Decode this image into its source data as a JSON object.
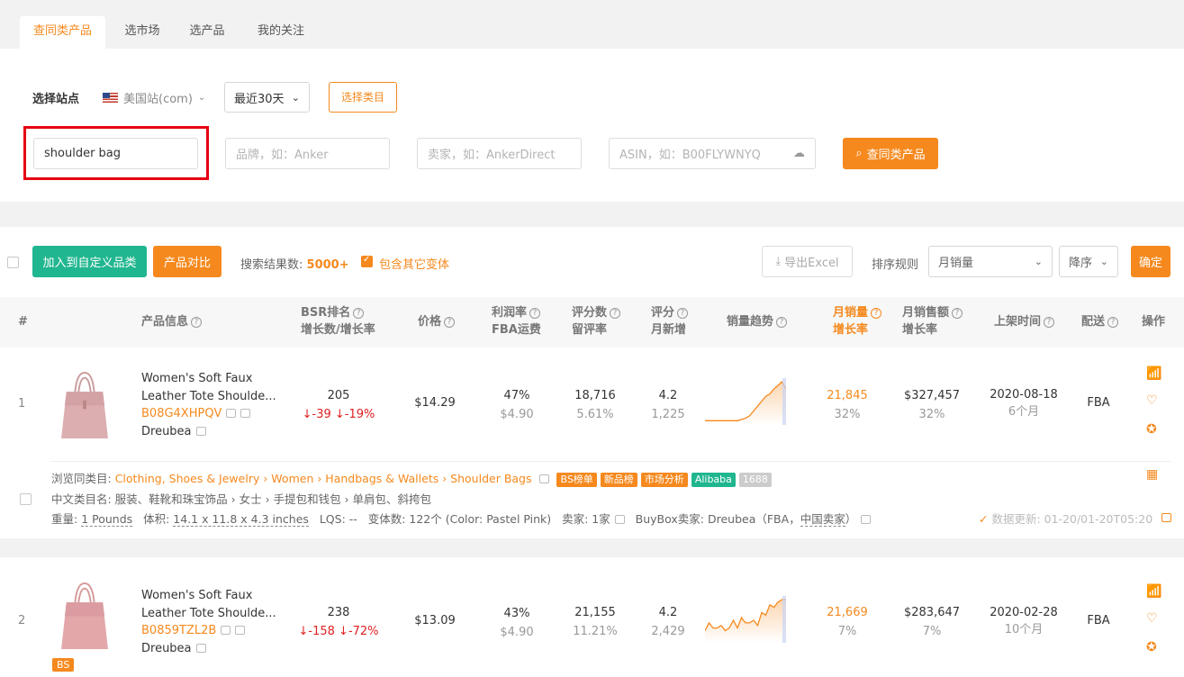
{
  "tabs": [
    {
      "label": "查同类产品",
      "active": true
    },
    {
      "label": "选市场"
    },
    {
      "label": "选产品"
    },
    {
      "label": "我的关注"
    }
  ],
  "filters": {
    "site_label": "选择站点",
    "site_value": "美国站(com)",
    "period_value": "最近30天",
    "category_button": "选择类目",
    "keyword_value": "shoulder bag",
    "brand_placeholder": "品牌，如：Anker",
    "seller_placeholder": "卖家，如：AnkerDirect",
    "asin_placeholder": "ASIN，如：B00FLYWNYQ",
    "search_button": "查同类产品"
  },
  "toolbar": {
    "add_category_button": "加入到自定义品类",
    "compare_button": "产品对比",
    "result_label": "搜索结果数:",
    "result_count": "5000+",
    "include_variants": "包含其它变体",
    "export_button": "导出Excel",
    "sort_label": "排序规则",
    "sort_field": "月销量",
    "sort_order": "降序",
    "confirm_button": "确定"
  },
  "columns": {
    "index": "#",
    "product": "产品信息",
    "bsr": "BSR排名",
    "bsr_sub": "增长数/增长率",
    "price": "价格",
    "profit": "利润率",
    "profit_sub": "FBA运费",
    "reviews": "评分数",
    "reviews_sub": "留评率",
    "rating": "评分",
    "rating_sub": "月新增",
    "trend": "销量趋势",
    "monthly_sales": "月销量",
    "monthly_sales_sub": "增长率",
    "monthly_revenue": "月销售额",
    "monthly_revenue_sub": "增长率",
    "listed": "上架时间",
    "delivery": "配送",
    "action": "操作"
  },
  "products": [
    {
      "index": "1",
      "title1": "Women's Soft Faux",
      "title2": "Leather Tote Shoulde...",
      "asin": "B08G4XHPQV",
      "brand": "Dreubea",
      "bsr": "205",
      "bsr_change": "-39",
      "bsr_rate": "-19%",
      "price": "$14.29",
      "profit": "47%",
      "fba": "$4.90",
      "reviews": "18,716",
      "review_rate": "5.61%",
      "rating": "4.2",
      "rating_new": "1,225",
      "sales": "21,845",
      "sales_rate": "32%",
      "revenue": "$327,457",
      "revenue_rate": "32%",
      "date": "2020-08-18",
      "age": "6个月",
      "delivery": "FBA",
      "browse_label": "浏览同类目:",
      "browse_path": "Clothing, Shoes & Jewelry › Women › Handbags & Wallets › Shoulder Bags",
      "tags": [
        "BS榜单",
        "新品榜",
        "市场分析",
        "Alibaba",
        "1688"
      ],
      "cn_category": "中文类目名: 服装、鞋靴和珠宝饰品 › 女士 › 手提包和钱包 › 单肩包、斜挎包",
      "weight_label": "重量:",
      "weight": "1 Pounds",
      "size_label": "体积:",
      "size": "14.1 x 11.8 x 4.3 inches",
      "lqs": "LQS: --",
      "variants": "变体数: 122个 (Color: Pastel Pink)",
      "sellers": "卖家: 1家",
      "buybox_label": "BuyBox卖家:",
      "buybox_name": "Dreubea（FBA，",
      "buybox_region": "中国卖家",
      "buybox_end": "）",
      "update": "数据更新: 01-20/01-20T05:20",
      "trend": [
        2,
        2,
        2,
        2,
        2,
        2,
        2,
        2,
        2,
        3,
        4,
        6,
        10,
        14,
        18,
        22,
        24,
        28,
        31,
        34,
        28
      ]
    },
    {
      "index": "2",
      "title1": "Women's Soft Faux",
      "title2": "Leather Tote Shoulde...",
      "asin": "B0859TZL2B",
      "brand": "Dreubea",
      "bsr": "238",
      "bsr_change": "-158",
      "bsr_rate": "-72%",
      "price": "$13.09",
      "profit": "43%",
      "fba": "$4.90",
      "reviews": "21,155",
      "review_rate": "11.21%",
      "rating": "4.2",
      "rating_new": "2,429",
      "sales": "21,669",
      "sales_rate": "7%",
      "revenue": "$283,647",
      "revenue_rate": "7%",
      "date": "2020-02-28",
      "age": "10个月",
      "delivery": "FBA",
      "badge": "BS",
      "trend": [
        8,
        14,
        10,
        10,
        12,
        8,
        10,
        16,
        10,
        18,
        14,
        14,
        16,
        12,
        22,
        20,
        28,
        26,
        30,
        32,
        32
      ]
    }
  ],
  "colors": {
    "accent": "#f5891e",
    "green": "#20b68f",
    "red": "#e02020",
    "highlight": "#e60012"
  }
}
